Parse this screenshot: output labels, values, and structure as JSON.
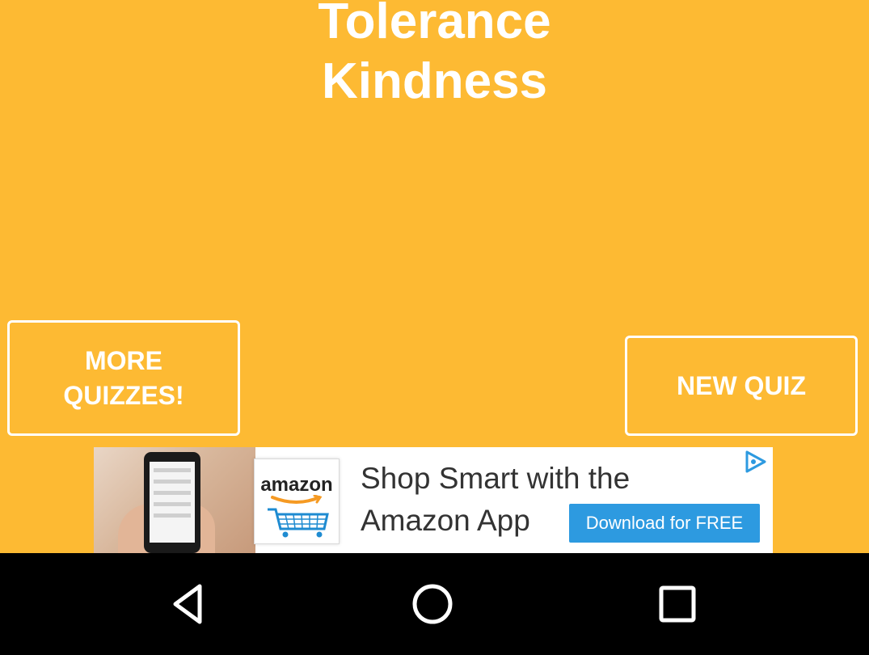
{
  "quiz": {
    "title_line_1": "Tolerance",
    "title_line_2": "Kindness"
  },
  "buttons": {
    "more_quizzes": "MORE QUIZZES!",
    "new_quiz": "NEW QUIZ"
  },
  "ad": {
    "brand": "amazon",
    "headline_line_1": "Shop Smart with the",
    "headline_line_2": "Amazon App",
    "cta": "Download for FREE"
  },
  "navbar": {
    "icons": [
      "back-icon",
      "home-icon",
      "recent-apps-icon"
    ]
  },
  "colors": {
    "background": "#FDBA33",
    "text": "#FFFFFF",
    "ad_cta": "#2D9AE0",
    "navbar": "#000000"
  }
}
